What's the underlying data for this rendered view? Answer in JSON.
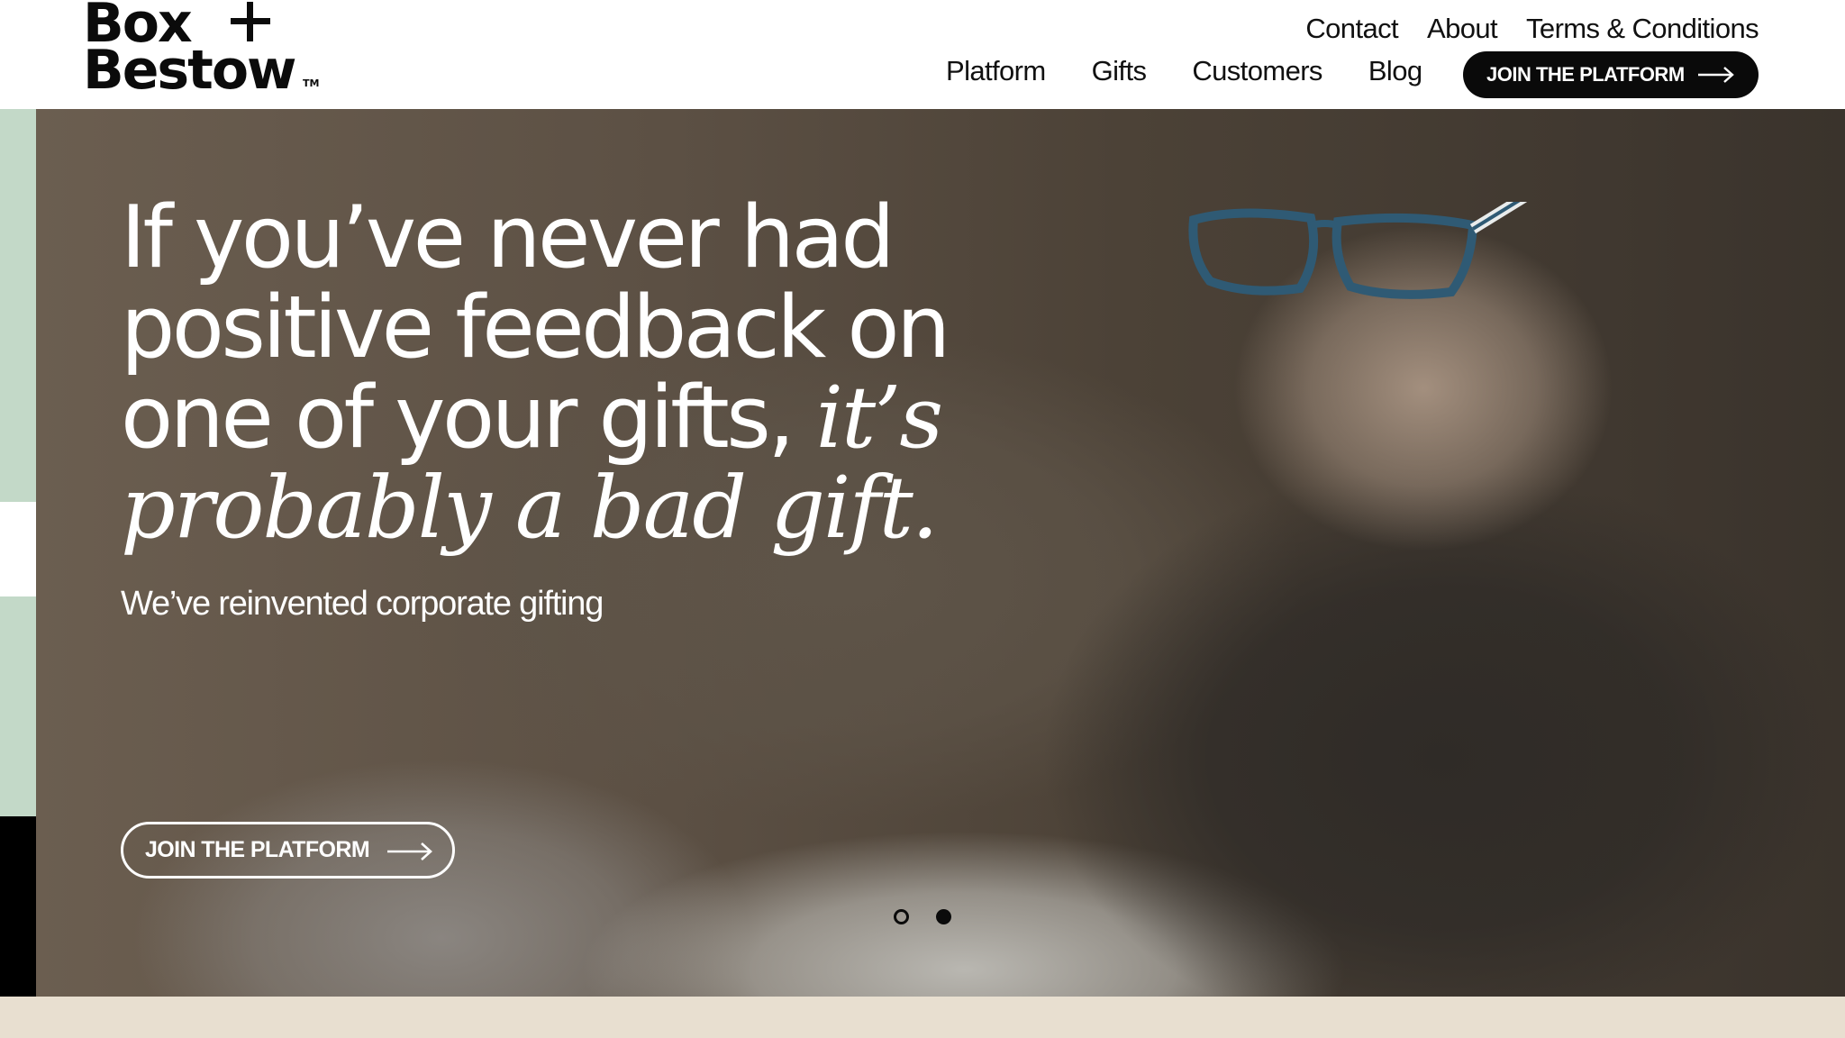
{
  "header": {
    "logo": {
      "line1": "Box",
      "line2": "Bestow",
      "tm": "TM"
    },
    "utility_nav": [
      "Contact",
      "About",
      "Terms & Conditions"
    ],
    "main_nav": [
      "Platform",
      "Gifts",
      "Customers",
      "Blog"
    ],
    "cta_label": "JOIN THE PLATFORM"
  },
  "hero": {
    "headline_line1": "If you’ve never had",
    "headline_line2": "positive feedback on",
    "headline_line3_plain": "one of your gifts, ",
    "headline_line3_italic": "it’s",
    "headline_line4_italic": "probably a bad gift.",
    "subhead": "We’ve reinvented corporate gifting",
    "cta_label": "JOIN THE PLATFORM",
    "carousel": {
      "slides": 2,
      "active_index": 2
    }
  },
  "colors": {
    "brand_black": "#0a0a0a",
    "sage_stripe": "#c3d9c8",
    "footer_band": "#e8dfd0",
    "hero_text": "#ffffff"
  },
  "icons": [
    "arrow-right-icon",
    "arrow-right-icon",
    "plus-icon"
  ]
}
